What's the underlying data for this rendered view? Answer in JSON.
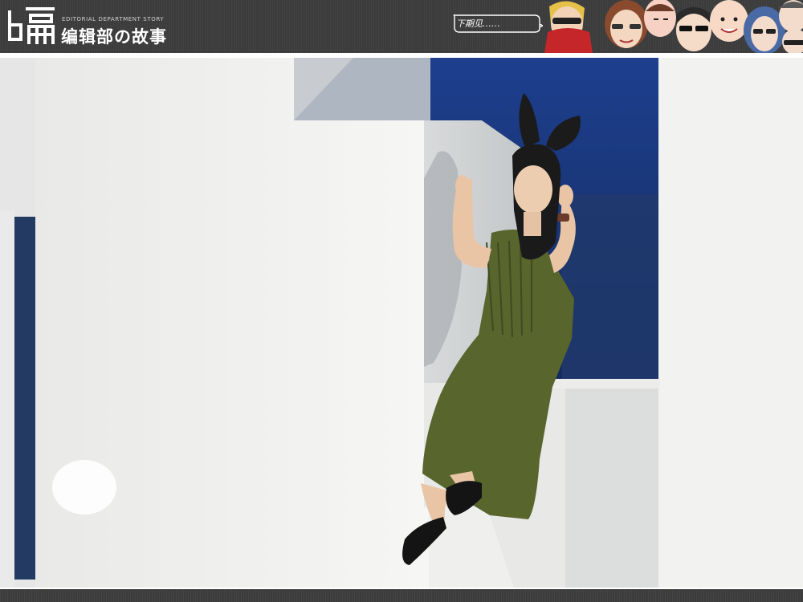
{
  "header": {
    "logo_subtitle": "EDITORIAL DEPARTMENT STORY",
    "logo_title": "编辑部の故事",
    "speech_bubble": "下期见……",
    "icons": [
      "logo-glyph-icon",
      "speech-bubble-icon",
      "cartoon-faces-icon"
    ]
  },
  "photo": {
    "subject": "woman-in-green-dress-with-bunny-ears",
    "colors": {
      "dress": "#5a6630",
      "backdrop_blue": "#1f3b7a",
      "wall": "#f1f1ef"
    }
  }
}
